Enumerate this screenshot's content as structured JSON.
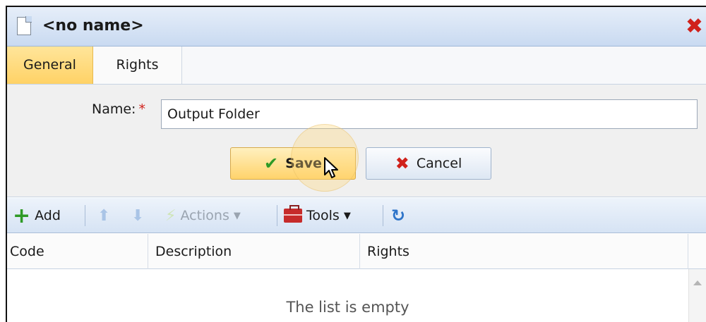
{
  "window": {
    "title": "<no name>",
    "icons": {
      "document": "document-icon",
      "close": "close-icon"
    },
    "colors": {
      "accent": "#ffd266",
      "close": "#d0211b"
    }
  },
  "tabs": [
    {
      "label": "General",
      "active": true
    },
    {
      "label": "Rights",
      "active": false
    }
  ],
  "form": {
    "name_label": "Name:",
    "required_marker": "*",
    "name_value": "Output Folder"
  },
  "buttons": {
    "save_label": "Save",
    "cancel_label": "Cancel"
  },
  "toolbar": {
    "add_label": "Add",
    "actions_label": "Actions",
    "tools_label": "Tools",
    "actions_enabled": false
  },
  "table": {
    "columns": [
      "Code",
      "Description",
      "Rights"
    ],
    "rows": [],
    "empty_message": "The list is empty"
  }
}
